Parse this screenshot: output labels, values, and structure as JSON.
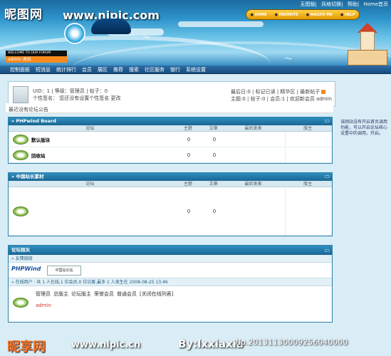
{
  "watermark": {
    "brand": "昵图网",
    "url": "www.nipic.com",
    "bottom_brand": "昵享网",
    "bottom_url": "www.nipic.cn",
    "by": "By:lxxiaxia",
    "no": "No.20131130009256040000"
  },
  "toplinks": [
    "无图版",
    "风格切换",
    "帮助",
    "Home首页"
  ],
  "header_buttons": [
    "HOME",
    "FAVORITE",
    "MAILTO ME",
    "HELP"
  ],
  "welcome": "WELCOME TO OUR FORUM",
  "admin_bar": "admin 退出",
  "nav": [
    "控制面板",
    "短消息",
    "统计排行",
    "会员",
    "展区",
    "推荐",
    "搜索",
    "社区服务",
    "银行",
    "系统设置"
  ],
  "user": {
    "uid_line": "UID：1 | 等级：管理员 | 帖子：0",
    "sign_line": "个性签名： 您还没有设置个性签名 更改",
    "today_line": "最后日:0 | 标记已读 | 精华区 | 最新帖子",
    "stats_line": "主题:0 | 帖子:0 | 会员:1 | 欢迎新会员 admin"
  },
  "notice": "最近没有论坛公告",
  "sidebar_text": "该网站没有开启首页调用功能，可以开启论坛核心设置中的调用，开启。",
  "boards": [
    {
      "title": "» PHPwind Board",
      "headers": [
        "论坛",
        "主题",
        "文章",
        "最后发表",
        "版主"
      ],
      "rows": [
        {
          "name": "默认版块",
          "topics": "0",
          "posts": "0"
        },
        {
          "name": "回收站",
          "topics": "0",
          "posts": "0"
        }
      ]
    },
    {
      "title": "» 中国站长素材",
      "headers": [
        "论坛",
        "主题",
        "文章",
        "最后发表",
        "版主"
      ],
      "rows": [
        {
          "name": "",
          "topics": "0",
          "posts": "0"
        }
      ]
    }
  ],
  "forum_related": {
    "title": "论坛相关",
    "friend_links": "» 友情链接",
    "link_logos": [
      "PHPWind",
      "中国站长站"
    ],
    "online_line": "» 在线用户 · 共 1 人在线,1 位会员,0 位访客,最多 1 人发生在 2008-08-25 13:46",
    "legend": [
      "管理员",
      "总版主",
      "论坛版主",
      "荣誉会员",
      "普通会员",
      "[关闭在线列表]"
    ],
    "online_user": "admin"
  }
}
